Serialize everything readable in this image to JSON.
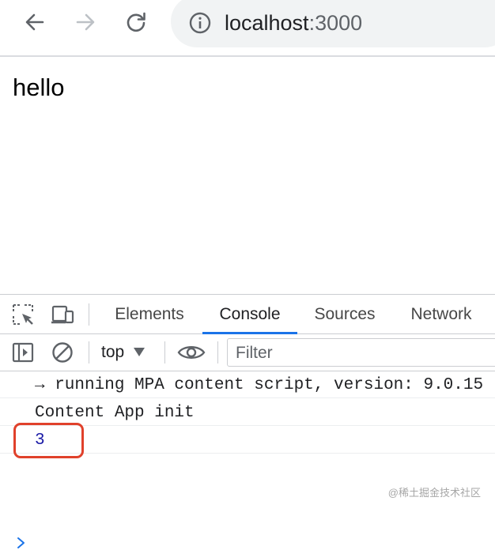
{
  "browser": {
    "url_host": "localhost",
    "url_port": ":3000"
  },
  "page": {
    "text": "hello"
  },
  "devtools": {
    "tabs": [
      {
        "label": "Elements",
        "active": false
      },
      {
        "label": "Console",
        "active": true
      },
      {
        "label": "Sources",
        "active": false
      },
      {
        "label": "Network",
        "active": false
      }
    ],
    "console_toolbar": {
      "context": "top",
      "filter_placeholder": "Filter"
    },
    "console_messages": [
      "→ running MPA content script, version: 9.0.15",
      "Content App init",
      "3"
    ],
    "highlight_color": "#e0412b",
    "active_tab_color": "#1a73e8"
  },
  "watermark": "@稀土掘金技术社区"
}
